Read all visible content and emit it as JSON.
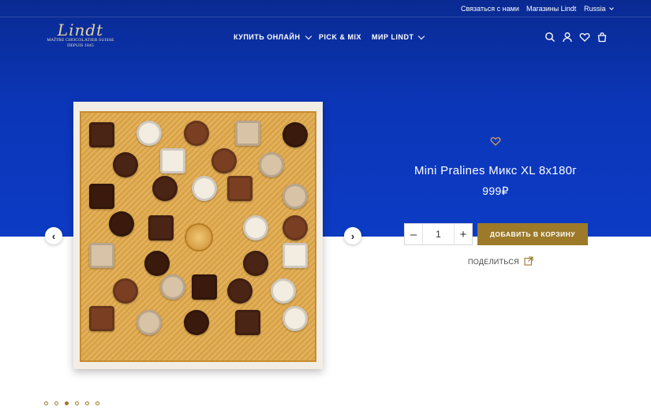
{
  "utility": {
    "contact": "Связаться с нами",
    "stores": "Магазины Lindt",
    "region": "Russia"
  },
  "logo": {
    "script": "Lindt",
    "line1": "MAÎTRE CHOCOLATIER SUISSE",
    "line2": "DEPUIS 1845"
  },
  "nav": {
    "items": [
      {
        "label": "КУПИТЬ ОНЛАЙН",
        "has_dropdown": true
      },
      {
        "label": "PICK & MIX",
        "has_dropdown": false
      },
      {
        "label": "МИР LINDT",
        "has_dropdown": true
      }
    ],
    "icons": [
      "search-icon",
      "account-icon",
      "wishlist-icon",
      "cart-icon"
    ]
  },
  "product": {
    "title": "Mini Pralines Микс XL 8x180г",
    "price": "999₽",
    "quantity": "1",
    "decrement": "–",
    "increment": "+",
    "add_to_cart": "ДОБАВИТЬ В КОРЗИНУ",
    "share": "ПОДЕЛИТЬСЯ"
  },
  "gallery": {
    "prev": "‹",
    "next": "›",
    "slide_count": 6,
    "active_slide": 3
  },
  "colors": {
    "hero_blue": "#0b36b8",
    "gold": "#9c7a2a",
    "logo_gold": "#e9d49b"
  }
}
